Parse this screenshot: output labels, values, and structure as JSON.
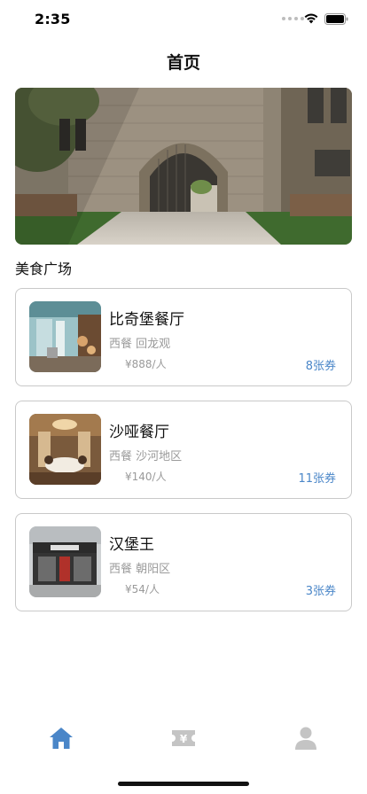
{
  "status": {
    "time": "2:35"
  },
  "header": {
    "title": "首页"
  },
  "section": {
    "title": "美食广场"
  },
  "colors": {
    "accent": "#4a86c8",
    "muted": "#9a9a9a",
    "border": "#c9c9c9",
    "tab_inactive": "#c4c4c4"
  },
  "restaurants": [
    {
      "name": "比奇堡餐厅",
      "category": "西餐 回龙观",
      "price": "¥888/人",
      "coupons": "8张券"
    },
    {
      "name": "沙哑餐厅",
      "category": "西餐 沙河地区",
      "price": "¥140/人",
      "coupons": "11张券"
    },
    {
      "name": "汉堡王",
      "category": "西餐 朝阳区",
      "price": "¥54/人",
      "coupons": "3张券"
    }
  ],
  "tabs": [
    {
      "icon": "home-icon",
      "active": true
    },
    {
      "icon": "coupon-icon",
      "active": false
    },
    {
      "icon": "user-icon",
      "active": false
    }
  ]
}
